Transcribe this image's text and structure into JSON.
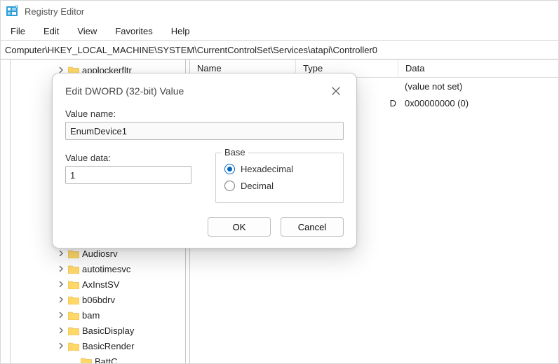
{
  "app": {
    "title": "Registry Editor"
  },
  "menu": [
    "File",
    "Edit",
    "View",
    "Favorites",
    "Help"
  ],
  "address": "Computer\\HKEY_LOCAL_MACHINE\\SYSTEM\\CurrentControlSet\\Services\\atapi\\Controller0",
  "tree": {
    "items": [
      {
        "label": "applockerfltr",
        "depth": 1,
        "expandable": true
      },
      {
        "label": "Audiosrv",
        "depth": 1,
        "expandable": true
      },
      {
        "label": "autotimesvc",
        "depth": 1,
        "expandable": true
      },
      {
        "label": "AxInstSV",
        "depth": 1,
        "expandable": true
      },
      {
        "label": "b06bdrv",
        "depth": 1,
        "expandable": true
      },
      {
        "label": "bam",
        "depth": 1,
        "expandable": true
      },
      {
        "label": "BasicDisplay",
        "depth": 1,
        "expandable": true
      },
      {
        "label": "BasicRender",
        "depth": 1,
        "expandable": true
      },
      {
        "label": "BattC",
        "depth": 2,
        "expandable": false
      }
    ]
  },
  "columns": {
    "name": "Name",
    "type": "Type",
    "data": "Data"
  },
  "rows": [
    {
      "name": "",
      "type": "",
      "data": "(value not set)"
    },
    {
      "name": "",
      "type": "D",
      "data": "0x00000000 (0)"
    }
  ],
  "dialog": {
    "title": "Edit DWORD (32-bit) Value",
    "value_name_label": "Value name:",
    "value_name": "EnumDevice1",
    "value_data_label": "Value data:",
    "value_data": "1",
    "base_label": "Base",
    "hex_label": "Hexadecimal",
    "dec_label": "Decimal",
    "ok": "OK",
    "cancel": "Cancel"
  }
}
